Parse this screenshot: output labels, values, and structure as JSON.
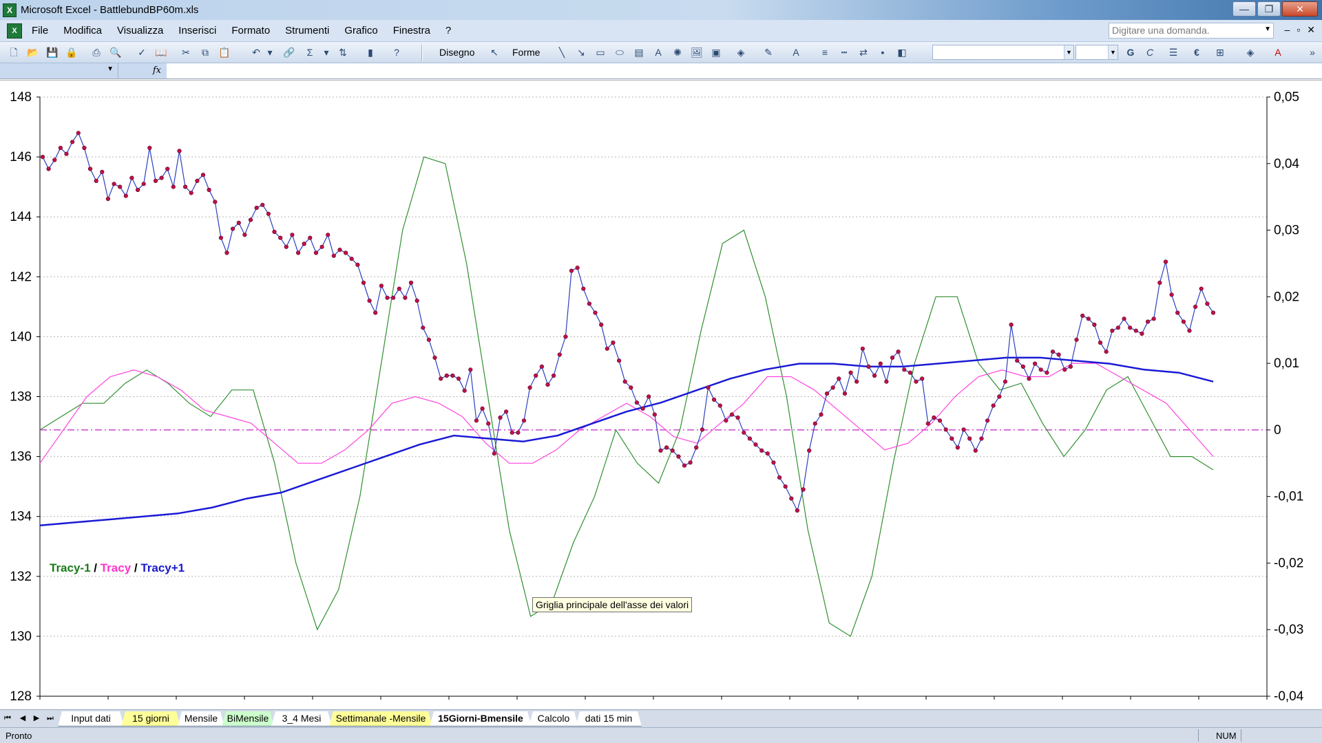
{
  "window": {
    "title": "Microsoft Excel - BattlebundBP60m.xls",
    "app_icon": "excel-icon"
  },
  "window_controls": {
    "minimize": "—",
    "restore": "❐",
    "close": "✕"
  },
  "menubar": {
    "items": [
      "File",
      "Modifica",
      "Visualizza",
      "Inserisci",
      "Formato",
      "Strumenti",
      "Grafico",
      "Finestra",
      "?"
    ],
    "help_placeholder": "Digitare una domanda.",
    "doc_controls": [
      "–",
      "▫",
      "✕"
    ]
  },
  "toolbar": {
    "drawing_label": "Disegno",
    "shapes_label": "Forme",
    "font_combo": "",
    "size_combo": "",
    "bold": "G",
    "italic": "C",
    "euro": "€"
  },
  "formula_bar": {
    "namebox": "",
    "fx": "fx"
  },
  "chart_data": {
    "type": "line",
    "y_left": {
      "ticks": [
        "148",
        "146",
        "144",
        "142",
        "140",
        "138",
        "136",
        "134",
        "132",
        "130",
        "128"
      ],
      "range": [
        128,
        148
      ]
    },
    "y_right": {
      "ticks": [
        "0,05",
        "0,04",
        "0,03",
        "0,02",
        "0,01",
        "0",
        "-0,01",
        "-0,02",
        "-0,03",
        "-0,04"
      ],
      "range": [
        -0.04,
        0.05
      ]
    },
    "grid": "horizontal dashed",
    "zero_line_color": "#cc44cc",
    "legend": {
      "placement": "left",
      "entries": [
        {
          "name": "Tracy-1",
          "color": "#1a7a1a"
        },
        {
          "name": "Tracy",
          "color": "#ff33cc"
        },
        {
          "name": "Tracy+1",
          "color": "#1a1acc"
        }
      ],
      "separator": " / "
    },
    "price_series": {
      "color_line": "#2a3fbf",
      "color_marker": "#c0104a",
      "values": [
        146.0,
        145.6,
        145.9,
        146.3,
        146.1,
        146.5,
        146.8,
        146.3,
        145.6,
        145.2,
        145.5,
        144.6,
        145.1,
        145.0,
        144.7,
        145.3,
        144.9,
        145.1,
        146.3,
        145.2,
        145.3,
        145.6,
        145.0,
        146.2,
        145.0,
        144.8,
        145.2,
        145.4,
        144.9,
        144.5,
        143.3,
        142.8,
        143.6,
        143.8,
        143.4,
        143.9,
        144.3,
        144.4,
        144.1,
        143.5,
        143.3,
        143.0,
        143.4,
        142.8,
        143.1,
        143.3,
        142.8,
        143.0,
        143.4,
        142.7,
        142.9,
        142.8,
        142.6,
        142.4,
        141.8,
        141.2,
        140.8,
        141.7,
        141.3,
        141.3,
        141.6,
        141.3,
        141.8,
        141.2,
        140.3,
        139.9,
        139.3,
        138.6,
        138.7,
        138.7,
        138.6,
        138.2,
        138.9,
        137.2,
        137.6,
        137.1,
        136.1,
        137.3,
        137.5,
        136.8,
        136.8,
        137.2,
        138.3,
        138.7,
        139.0,
        138.4,
        138.7,
        139.4,
        140.0,
        142.2,
        142.3,
        141.6,
        141.1,
        140.8,
        140.4,
        139.6,
        139.8,
        139.2,
        138.5,
        138.3,
        137.8,
        137.6,
        138.0,
        137.4,
        136.2,
        136.3,
        136.2,
        136.0,
        135.7,
        135.8,
        136.3,
        136.9,
        138.3,
        137.9,
        137.7,
        137.2,
        137.4,
        137.3,
        136.8,
        136.6,
        136.4,
        136.2,
        136.1,
        135.8,
        135.3,
        135.0,
        134.6,
        134.2,
        134.9,
        136.2,
        137.1,
        137.4,
        138.1,
        138.3,
        138.6,
        138.1,
        138.8,
        138.5,
        139.6,
        139.0,
        138.7,
        139.1,
        138.5,
        139.3,
        139.5,
        138.9,
        138.8,
        138.5,
        138.6,
        137.1,
        137.3,
        137.2,
        136.9,
        136.6,
        136.3,
        136.9,
        136.6,
        136.2,
        136.6,
        137.2,
        137.7,
        138.0,
        138.5,
        140.4,
        139.2,
        139.0,
        138.6,
        139.1,
        138.9,
        138.8,
        139.5,
        139.4,
        138.9,
        139.0,
        139.9,
        140.7,
        140.6,
        140.4,
        139.8,
        139.5,
        140.2,
        140.3,
        140.6,
        140.3,
        140.2,
        140.1,
        140.5,
        140.6,
        141.8,
        142.5,
        141.4,
        140.8,
        140.5,
        140.2,
        141.0,
        141.6,
        141.1,
        140.8
      ]
    },
    "tracy_minus1": {
      "color": "#2f8f2f"
    },
    "tracy": {
      "color": "#ff44dd"
    },
    "tracy_plus1": {
      "color": "#1a1ad6"
    }
  },
  "tooltip": "Griglia principale dell'asse dei valori",
  "sheet_tabs": [
    {
      "label": "Input dati",
      "color": "#ffffff"
    },
    {
      "label": "15 giorni",
      "color": "#ffff99"
    },
    {
      "label": "Mensile",
      "color": "#ffffff"
    },
    {
      "label": "BiMensile",
      "color": "#ccffcc"
    },
    {
      "label": "3_4 Mesi",
      "color": "#ffffff"
    },
    {
      "label": "Settimanale -Mensile",
      "color": "#ffff99"
    },
    {
      "label": "15Giorni-Bmensile",
      "color": "#ffffff",
      "active": true
    },
    {
      "label": "Calcolo",
      "color": "#ffffff"
    },
    {
      "label": "dati 15 min",
      "color": "#ffffff"
    }
  ],
  "status": {
    "left": "Pronto",
    "num": "NUM"
  }
}
